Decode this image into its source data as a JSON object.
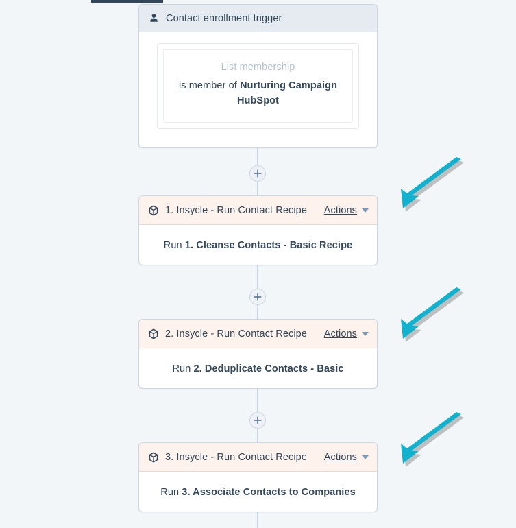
{
  "app": {
    "background_color": "#f3f6f8",
    "top_bar_color": "#33475b"
  },
  "trigger": {
    "icon": "person-icon",
    "title": "Contact enrollment trigger",
    "filter": {
      "label": "List membership",
      "prefix": "is member of ",
      "value": "Nurturing Campaign HubSpot"
    }
  },
  "actions_menu": {
    "label": "Actions",
    "caret_icon": "chevron-down-icon"
  },
  "action_cards": [
    {
      "icon": "cube-icon",
      "header": "1. Insycle - Run Contact Recipe",
      "body_prefix": "Run ",
      "body_value": "1. Cleanse Contacts - Basic Recipe"
    },
    {
      "icon": "cube-icon",
      "header": "2. Insycle - Run Contact Recipe",
      "body_prefix": "Run ",
      "body_value": "2. Deduplicate Contacts - Basic"
    },
    {
      "icon": "cube-icon",
      "header": "3. Insycle - Run Contact Recipe",
      "body_prefix": "Run ",
      "body_value": "3. Associate Contacts to Companies"
    }
  ],
  "connectors": {
    "add_step_icon": "plus-icon",
    "line_color": "#cbd6e2"
  },
  "annotations": {
    "arrow_color": "#12b2cf",
    "arrows": [
      {
        "name": "arrow-pointing-to-action-1"
      },
      {
        "name": "arrow-pointing-to-action-2"
      },
      {
        "name": "arrow-pointing-to-action-3"
      }
    ]
  }
}
